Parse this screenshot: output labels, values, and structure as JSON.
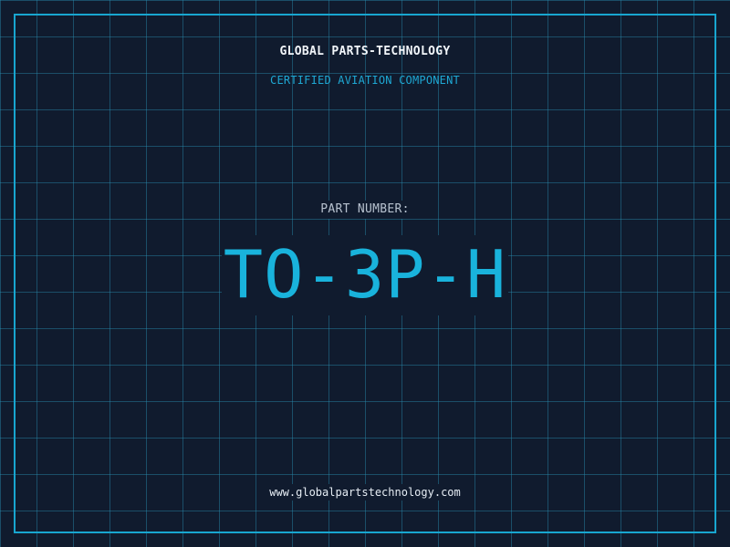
{
  "header": {
    "company": "GLOBAL PARTS-TECHNOLOGY",
    "subtitle": "CERTIFIED AVIATION COMPONENT"
  },
  "part": {
    "label": "PART NUMBER:",
    "number": "TO-3P-H"
  },
  "footer": {
    "url": "www.globalpartstechnology.com"
  },
  "colors": {
    "background": "#101b2e",
    "grid": "#288caf",
    "accent": "#19b3dc",
    "frame": "#18a6d0",
    "heading": "#f2f6fa",
    "label": "#b7c2cf"
  }
}
